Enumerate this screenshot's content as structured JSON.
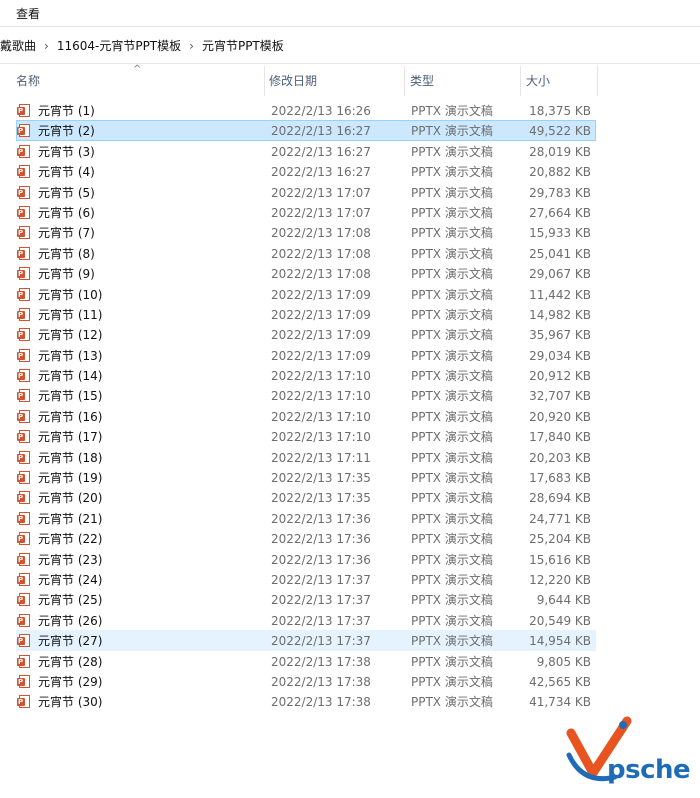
{
  "menu": {
    "view_label": "查看"
  },
  "breadcrumb": [
    "戴歌曲",
    "11604-元宵节PPT模板",
    "元宵节PPT模板"
  ],
  "columns": {
    "name": "名称",
    "date": "修改日期",
    "type": "类型",
    "size": "大小"
  },
  "files": [
    {
      "name": "元宵节 (1)",
      "date": "2022/2/13 16:26",
      "type": "PPTX 演示文稿",
      "size": "18,375 KB"
    },
    {
      "name": "元宵节 (2)",
      "date": "2022/2/13 16:27",
      "type": "PPTX 演示文稿",
      "size": "49,522 KB"
    },
    {
      "name": "元宵节 (3)",
      "date": "2022/2/13 16:27",
      "type": "PPTX 演示文稿",
      "size": "28,019 KB"
    },
    {
      "name": "元宵节 (4)",
      "date": "2022/2/13 16:27",
      "type": "PPTX 演示文稿",
      "size": "20,882 KB"
    },
    {
      "name": "元宵节 (5)",
      "date": "2022/2/13 17:07",
      "type": "PPTX 演示文稿",
      "size": "29,783 KB"
    },
    {
      "name": "元宵节 (6)",
      "date": "2022/2/13 17:07",
      "type": "PPTX 演示文稿",
      "size": "27,664 KB"
    },
    {
      "name": "元宵节 (7)",
      "date": "2022/2/13 17:08",
      "type": "PPTX 演示文稿",
      "size": "15,933 KB"
    },
    {
      "name": "元宵节 (8)",
      "date": "2022/2/13 17:08",
      "type": "PPTX 演示文稿",
      "size": "25,041 KB"
    },
    {
      "name": "元宵节 (9)",
      "date": "2022/2/13 17:08",
      "type": "PPTX 演示文稿",
      "size": "29,067 KB"
    },
    {
      "name": "元宵节 (10)",
      "date": "2022/2/13 17:09",
      "type": "PPTX 演示文稿",
      "size": "11,442 KB"
    },
    {
      "name": "元宵节 (11)",
      "date": "2022/2/13 17:09",
      "type": "PPTX 演示文稿",
      "size": "14,982 KB"
    },
    {
      "name": "元宵节 (12)",
      "date": "2022/2/13 17:09",
      "type": "PPTX 演示文稿",
      "size": "35,967 KB"
    },
    {
      "name": "元宵节 (13)",
      "date": "2022/2/13 17:09",
      "type": "PPTX 演示文稿",
      "size": "29,034 KB"
    },
    {
      "name": "元宵节 (14)",
      "date": "2022/2/13 17:10",
      "type": "PPTX 演示文稿",
      "size": "20,912 KB"
    },
    {
      "name": "元宵节 (15)",
      "date": "2022/2/13 17:10",
      "type": "PPTX 演示文稿",
      "size": "32,707 KB"
    },
    {
      "name": "元宵节 (16)",
      "date": "2022/2/13 17:10",
      "type": "PPTX 演示文稿",
      "size": "20,920 KB"
    },
    {
      "name": "元宵节 (17)",
      "date": "2022/2/13 17:10",
      "type": "PPTX 演示文稿",
      "size": "17,840 KB"
    },
    {
      "name": "元宵节 (18)",
      "date": "2022/2/13 17:11",
      "type": "PPTX 演示文稿",
      "size": "20,203 KB"
    },
    {
      "name": "元宵节 (19)",
      "date": "2022/2/13 17:35",
      "type": "PPTX 演示文稿",
      "size": "17,683 KB"
    },
    {
      "name": "元宵节 (20)",
      "date": "2022/2/13 17:35",
      "type": "PPTX 演示文稿",
      "size": "28,694 KB"
    },
    {
      "name": "元宵节 (21)",
      "date": "2022/2/13 17:36",
      "type": "PPTX 演示文稿",
      "size": "24,771 KB"
    },
    {
      "name": "元宵节 (22)",
      "date": "2022/2/13 17:36",
      "type": "PPTX 演示文稿",
      "size": "25,204 KB"
    },
    {
      "name": "元宵节 (23)",
      "date": "2022/2/13 17:36",
      "type": "PPTX 演示文稿",
      "size": "15,616 KB"
    },
    {
      "name": "元宵节 (24)",
      "date": "2022/2/13 17:37",
      "type": "PPTX 演示文稿",
      "size": "12,220 KB"
    },
    {
      "name": "元宵节 (25)",
      "date": "2022/2/13 17:37",
      "type": "PPTX 演示文稿",
      "size": "9,644 KB"
    },
    {
      "name": "元宵节 (26)",
      "date": "2022/2/13 17:37",
      "type": "PPTX 演示文稿",
      "size": "20,549 KB"
    },
    {
      "name": "元宵节 (27)",
      "date": "2022/2/13 17:37",
      "type": "PPTX 演示文稿",
      "size": "14,954 KB"
    },
    {
      "name": "元宵节 (28)",
      "date": "2022/2/13 17:38",
      "type": "PPTX 演示文稿",
      "size": "9,805 KB"
    },
    {
      "name": "元宵节 (29)",
      "date": "2022/2/13 17:38",
      "type": "PPTX 演示文稿",
      "size": "42,565 KB"
    },
    {
      "name": "元宵节 (30)",
      "date": "2022/2/13 17:38",
      "type": "PPTX 演示文稿",
      "size": "41,734 KB"
    }
  ],
  "selected_index": 1,
  "hovered_index": 26,
  "file_icon": "powerpoint-file-icon",
  "icon_glyph": "P",
  "watermark": {
    "text": "psche"
  },
  "colors": {
    "selected_bg": "#cce8ff",
    "hover_bg": "#e5f3ff",
    "ppt_orange": "#d35230",
    "brand_blue": "#1e6cb7"
  }
}
